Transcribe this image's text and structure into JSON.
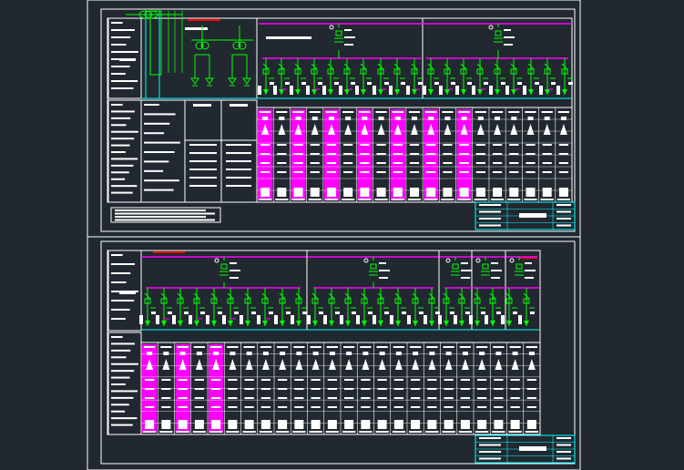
{
  "colors": {
    "background": "#212830",
    "frame": "#ffffff",
    "busbar": "#ff00ff",
    "wiring": "#00ff00",
    "cyan_line": "#00ffff",
    "red_mark": "#ff0000",
    "magenta_fill": "#ff00ff"
  },
  "sheets": [
    {
      "id": "sheet-1",
      "feeder_groups": 2,
      "feeders": 19,
      "magenta_table_columns": [
        0,
        2,
        4,
        6,
        8,
        10,
        12
      ],
      "has_transformer_section": true
    },
    {
      "id": "sheet-2",
      "feeder_groups": 3,
      "feeders": 24,
      "magenta_table_columns": [
        0,
        2,
        4
      ],
      "has_transformer_section": false
    }
  ],
  "icons": [
    "breaker-icon",
    "transformer-icon",
    "ground-icon",
    "arrow-icon"
  ]
}
